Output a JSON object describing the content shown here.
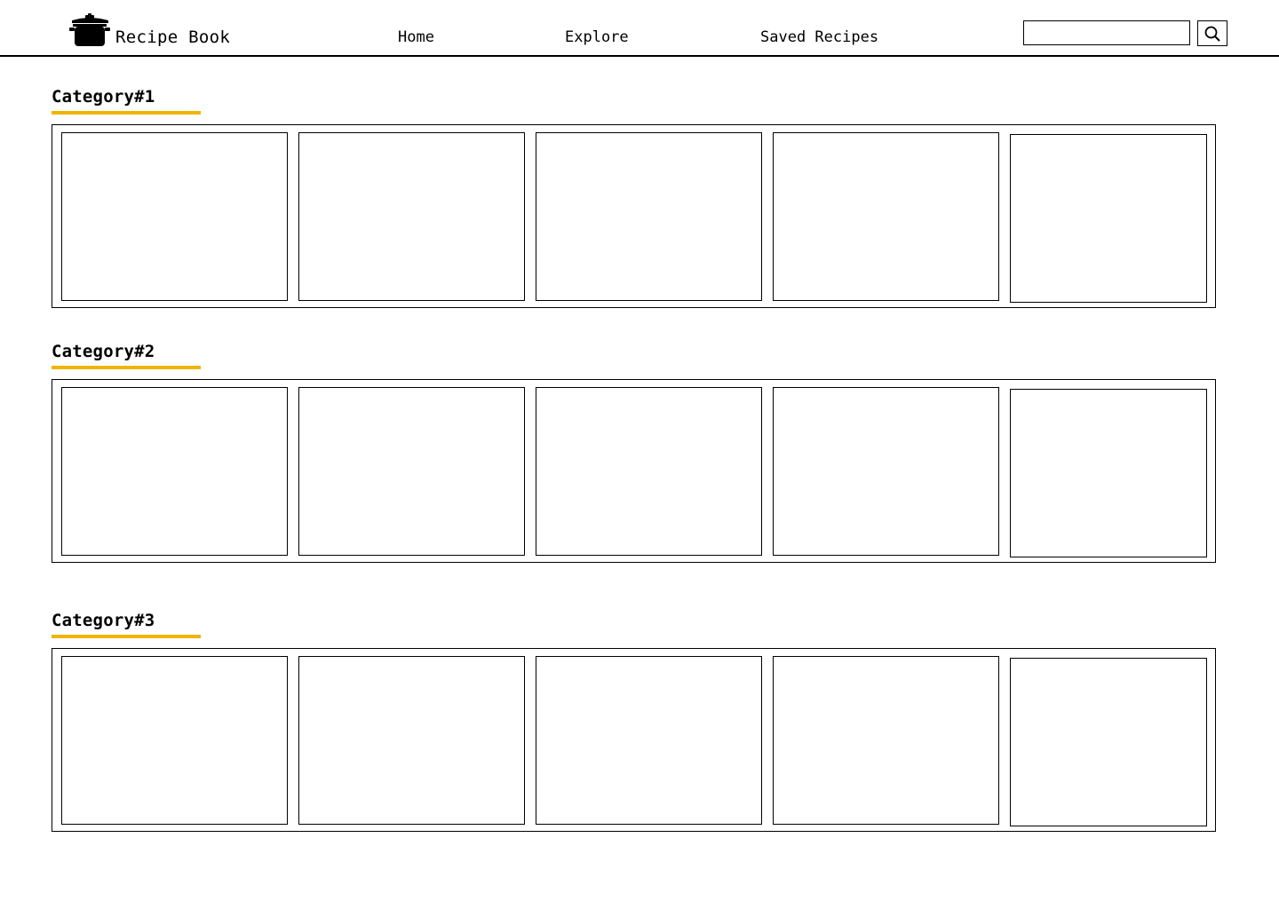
{
  "header": {
    "brand": "Recipe Book",
    "logo_icon": "cooking-pot-icon",
    "nav": [
      "Home",
      "Explore",
      "Saved Recipes"
    ],
    "search": {
      "placeholder": "",
      "value": "",
      "button_icon": "search-icon"
    }
  },
  "colors": {
    "accent": "#F0B400",
    "border": "#000000",
    "background": "#FFFFFF"
  },
  "categories": [
    {
      "title": "Category#1",
      "card_count": 5
    },
    {
      "title": "Category#2",
      "card_count": 5
    },
    {
      "title": "Category#3",
      "card_count": 5
    }
  ]
}
